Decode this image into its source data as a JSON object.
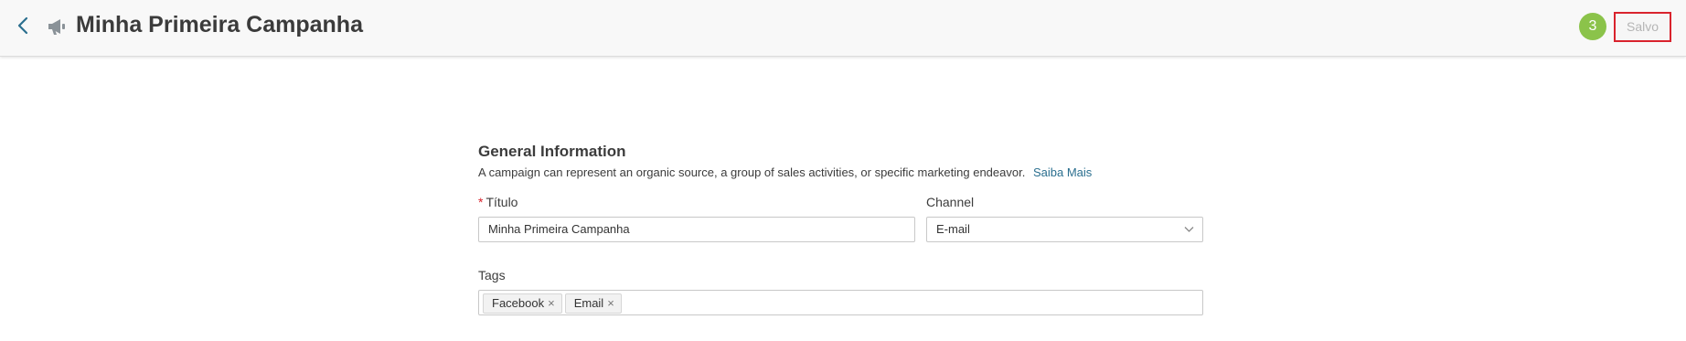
{
  "header": {
    "title": "Minha Primeira Campanha",
    "step": "3",
    "saved_label": "Salvo"
  },
  "form": {
    "section_title": "General Information",
    "section_desc": "A campaign can represent an organic source, a group of sales activities, or specific marketing endeavor.",
    "learn_more": "Saiba Mais",
    "title_field": {
      "required_mark": "*",
      "label": "Título",
      "value": "Minha Primeira Campanha"
    },
    "channel_field": {
      "label": "Channel",
      "value": "E-mail"
    },
    "tags_field": {
      "label": "Tags",
      "tags": [
        {
          "label": "Facebook",
          "remove": "×"
        },
        {
          "label": "Email",
          "remove": "×"
        }
      ]
    }
  },
  "colors": {
    "accent": "#2b6f8f",
    "badge": "#8bc34a",
    "highlight": "#d9232d",
    "required": "#d9232d"
  },
  "icons": {
    "back": "chevron-left-icon",
    "campaign": "megaphone-icon",
    "dropdown": "chevron-down-icon",
    "tag_remove": "close-icon"
  }
}
